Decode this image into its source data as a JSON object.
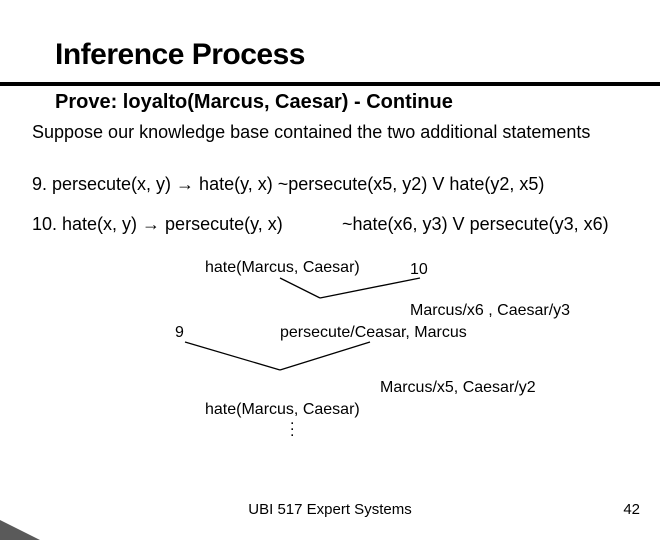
{
  "title": "Inference Process",
  "subtitle": "Prove: loyalto(Marcus, Caesar)  - Continue",
  "intro": "Suppose our knowledge base contained the two additional statements",
  "stmt9": "9. persecute(x, y) → hate(y, x)  ~persecute(x5, y2) V hate(y2, x5)",
  "stmt10": "10. hate(x, y) → persecute(y, x)",
  "clause10": "~hate(x6, y3) V persecute(y3, x6)",
  "derivation": {
    "top": "hate(Marcus, Caesar)",
    "label10": "10",
    "sub1": "Marcus/x6 , Caesar/y3",
    "label9": "9",
    "res1": "persecute/Ceasar, Marcus",
    "sub2": "Marcus/x5, Caesar/y2",
    "res2": "hate(Marcus, Caesar)"
  },
  "footer": "UBI 517 Expert Systems",
  "page": "42"
}
